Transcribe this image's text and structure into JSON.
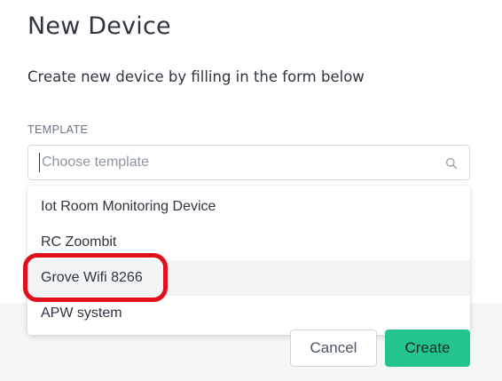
{
  "dialog": {
    "title": "New Device",
    "subtitle": "Create new device by filling in the form below"
  },
  "template_field": {
    "label": "TEMPLATE",
    "placeholder": "Choose template",
    "value": "",
    "icon": "search-icon"
  },
  "dropdown": {
    "options": [
      {
        "label": "Iot Room Monitoring Device"
      },
      {
        "label": "RC Zoombit"
      },
      {
        "label": "Grove Wifi 8266"
      },
      {
        "label": "APW system"
      }
    ],
    "hovered_index": 2,
    "highlight_color": "#e0101d"
  },
  "footer": {
    "cancel_label": "Cancel",
    "create_label": "Create",
    "create_color": "#23c48e"
  }
}
